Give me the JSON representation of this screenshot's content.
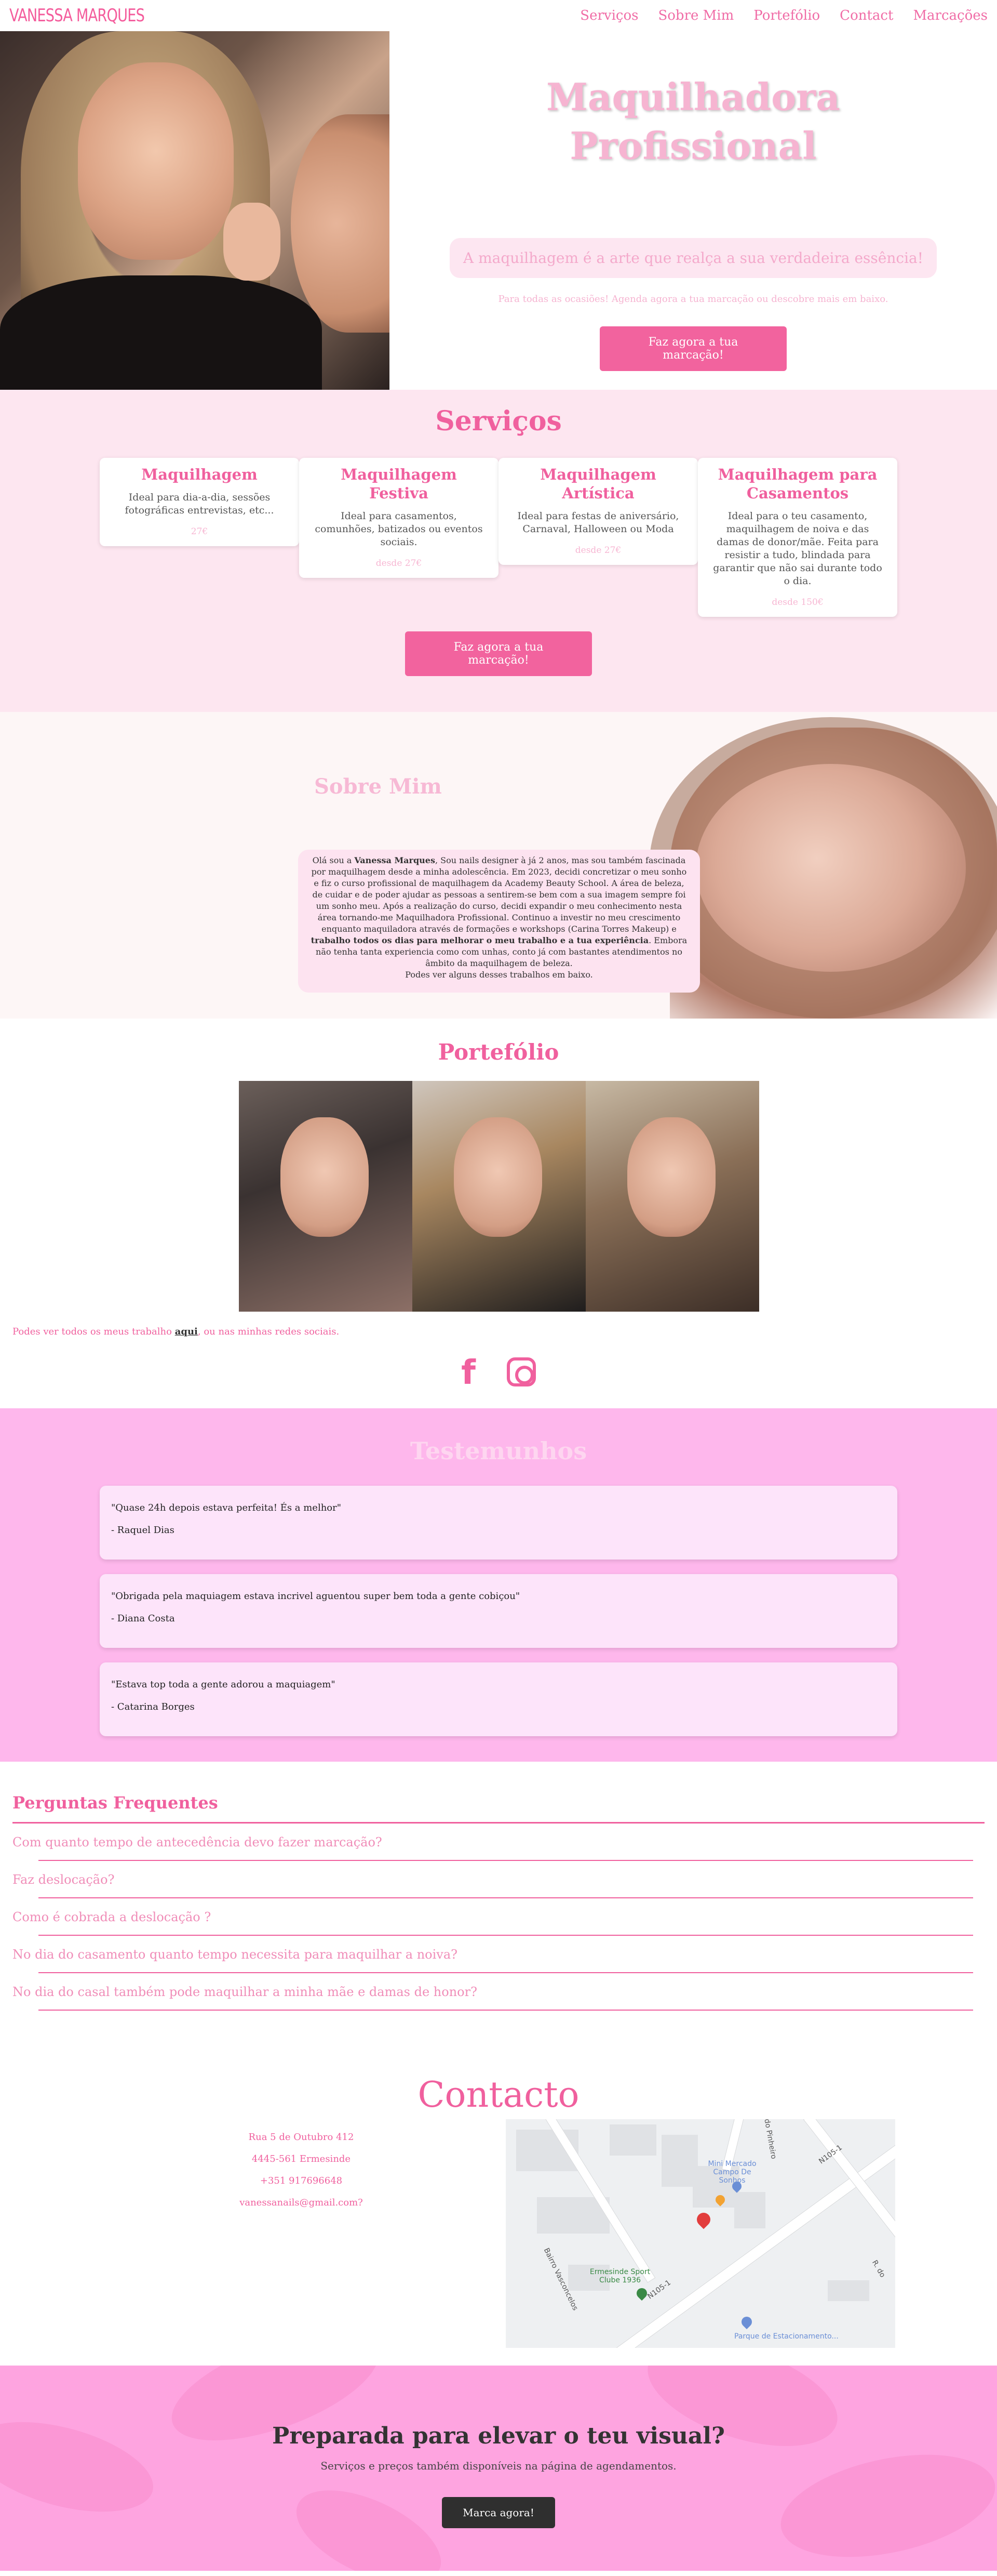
{
  "nav": {
    "logo": "VANESSA MARQUES",
    "links": [
      "Serviços",
      "Sobre Mim",
      "Portefólio",
      "Contact",
      "Marcações"
    ]
  },
  "hero": {
    "title": "Maquilhadora Profissional",
    "tagline": "A maquilhagem é a arte que realça a sua verdadeira essência!",
    "subtitle": "Para todas as ocasiões! Agenda agora a tua marcação ou descobre mais em baixo.",
    "button": "Faz agora a tua marcação!"
  },
  "services": {
    "title": "Serviços",
    "cards": [
      {
        "title": "Maquilhagem",
        "description": "Ideal para dia-a-dia, sessões fotográficas entrevistas, etc...",
        "price": "27€"
      },
      {
        "title": "Maquilhagem Festiva",
        "description": "Ideal para casamentos, comunhões, batizados ou eventos sociais.",
        "price": "desde 27€"
      },
      {
        "title": "Maquilhagem Artística",
        "description": "Ideal para festas de aniversário, Carnaval, Halloween ou Moda",
        "price": "desde 27€"
      },
      {
        "title": "Maquilhagem para Casamentos",
        "description": "Ideal para o teu casamento, maquilhagem de noiva e das damas de donor/mãe. Feita para resistir a tudo, blindada para garantir que não sai durante todo o dia.",
        "price": "desde 150€"
      }
    ],
    "button": "Faz agora a tua marcação!"
  },
  "about": {
    "title": "Sobre Mim",
    "p1": "Olá sou a ",
    "name": "Vanessa Marques",
    "p2": ", Sou nails designer à já 2 anos, mas sou também fascinada por maquilhagem desde a minha adolescência. Em 2023, decidi concretizar o meu sonho e fiz o curso profissional de maquilhagem da Academy Beauty School. A área de beleza, de cuidar e de poder ajudar as pessoas a sentirem-se bem com a sua imagem sempre foi um sonho meu. Após a realização do curso, decidi expandir o meu conhecimento nesta área tornando-me Maquilhadora Profissional. Continuo a investir no meu crescimento enquanto maquiladora através de formações e workshops (Carina Torres Makeup) e ",
    "bold": "trabalho todos os dias para melhorar o meu trabalho e a tua experiência",
    "p3": ". Embora não tenha tanta experiencia como com unhas, conto já com bastantes atendimentos no âmbito da maquilhagem de beleza.",
    "p4": "Podes ver alguns desses trabalhos em baixo."
  },
  "portfolio": {
    "title": "Portefólio",
    "text_before": "Podes ver todos os meus trabalho ",
    "link": "aqui",
    "text_after": ", ou nas minhas redes sociais."
  },
  "socials": {
    "facebook_icon": "f",
    "instagram_icon": "instagram-icon"
  },
  "testimonials": {
    "title": "Testemunhos",
    "items": [
      {
        "quote": "\"Quase 24h depois estava perfeita! És a melhor\"",
        "author": "- Raquel Dias"
      },
      {
        "quote": "\"Obrigada pela maquiagem estava incrivel aguentou super bem toda a gente cobiçou\"",
        "author": "- Diana Costa"
      },
      {
        "quote": "\"Estava top toda a gente adorou a maquiagem\"",
        "author": "- Catarina Borges"
      }
    ]
  },
  "faq": {
    "title": "Perguntas Frequentes",
    "items": [
      "Com quanto tempo de antecedência devo fazer marcação?",
      "Faz deslocação?",
      "Como é cobrada a deslocação ?",
      "No dia do casamento quanto tempo necessita para maquilhar a noiva?",
      "No dia do casal também pode maquilhar a minha mãe e damas de honor?"
    ]
  },
  "contact": {
    "title": "Contacto",
    "address1": "Rua 5 de Outubro 412",
    "address2": "4445-561 Ermesinde",
    "phone": "+351 917696648",
    "email": "vanessanails@gmail.com?",
    "map": {
      "labels": [
        "Mini Mercado Campo De Sonhos",
        "Ermesinde Sport Clube 1936",
        "Parque de Estacionamento...",
        "N105-1",
        "N105-1",
        "Bairro Vasconcelos",
        "do Pinheiro",
        "R. do"
      ]
    }
  },
  "cta": {
    "title": "Preparada para elevar o teu visual?",
    "subtitle": "Serviços e preços também disponíveis na página de agendamentos.",
    "button": "Marca agora!"
  },
  "colors": {
    "accent": "#f0609e",
    "services_bg": "#fde6f0",
    "testimonials_bg": "#feb7ec",
    "cta_bg": "#fea4e0"
  }
}
